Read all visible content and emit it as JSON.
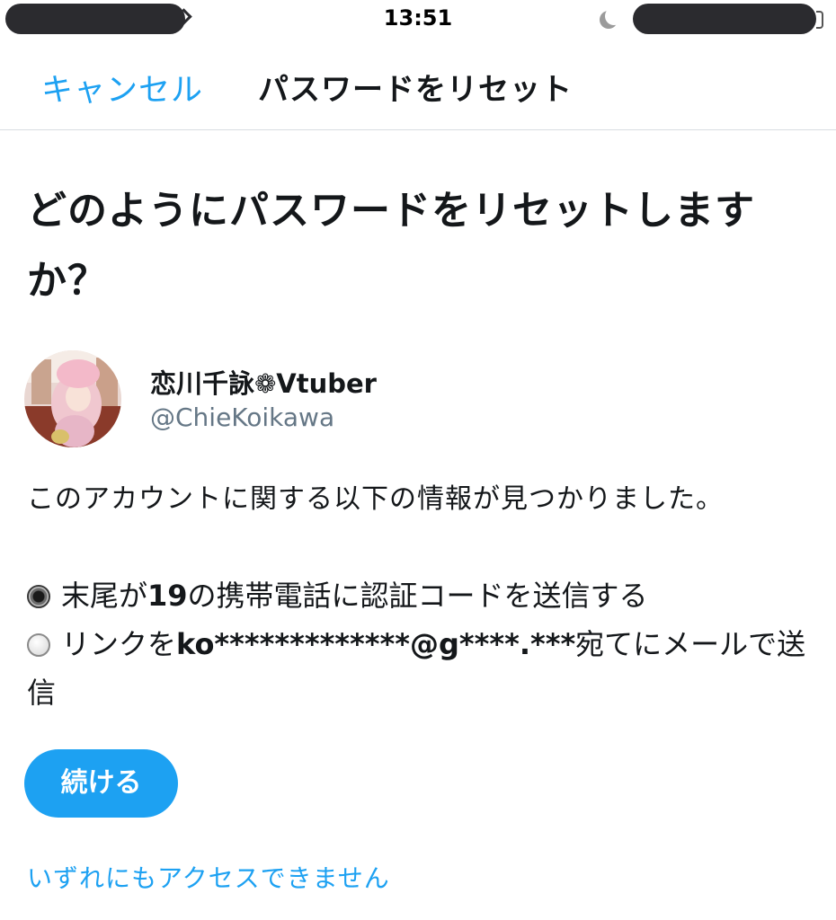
{
  "status_bar": {
    "time": "13:51",
    "icons": [
      "moon-icon",
      "battery-icon"
    ]
  },
  "nav": {
    "cancel_label": "キャンセル",
    "title": "パスワードをリセット"
  },
  "heading": "どのようにパスワードをリセットしますか？",
  "account": {
    "display_name": "恋川千詠❁Vtuber",
    "handle": "@ChieKoikawa"
  },
  "found_text": "このアカウントに関する以下の情報が見つかりました。",
  "options": [
    {
      "selected": true,
      "prefix": "末尾が",
      "bold": "19",
      "suffix": "の携帯電話に認証コードを送信する"
    },
    {
      "selected": false,
      "prefix": "リンクを",
      "bold": "ko*************@g****.***",
      "suffix": "宛てにメールで送信"
    }
  ],
  "continue_label": "続ける",
  "no_access_link": "いずれにもアクセスできません",
  "colors": {
    "accent": "#1da1f2",
    "text": "#14171a",
    "secondary_text": "#657786",
    "divider": "#d8dde1"
  }
}
